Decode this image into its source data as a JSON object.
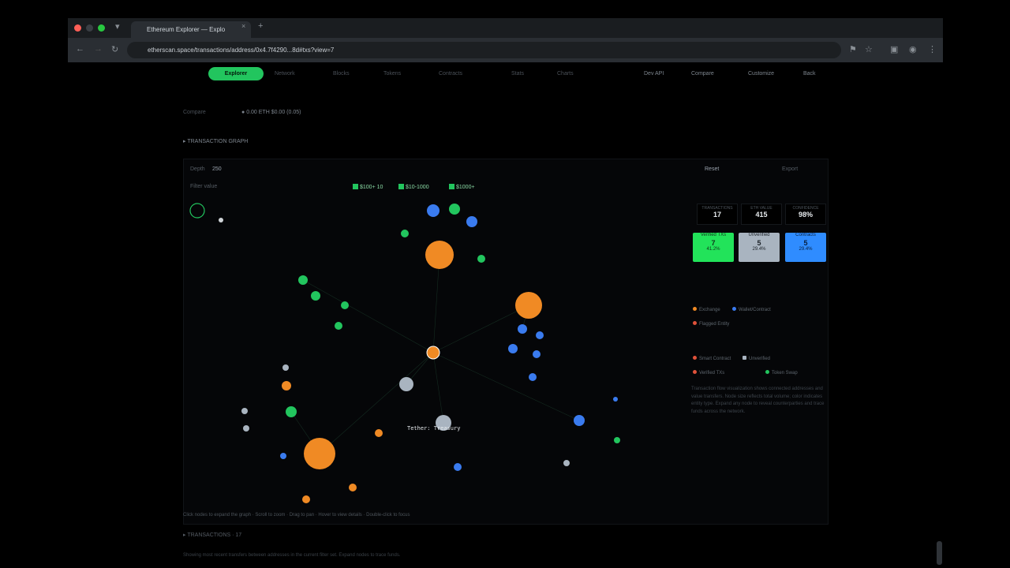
{
  "browser": {
    "tab_title": "Ethereum Explorer — Explo",
    "url": "etherscan.space/transactions/address/0x4.7f4290...8d#txs?view=7"
  },
  "nav": {
    "active": "Explorer",
    "items": [
      "Network",
      "Blocks",
      "Tokens",
      "Contracts",
      "Stats",
      "Charts"
    ],
    "right": [
      "Dev API",
      "Compare",
      "Customize",
      "Back"
    ]
  },
  "subnav": {
    "selected_label": "Compare",
    "selected_value": "0.00 ETH  $0.00 (0.05)"
  },
  "section_title": "▸ TRANSACTION GRAPH",
  "controls": {
    "depth_label": "Depth",
    "depth_value": "250",
    "filters_label": "Filter value",
    "chips": [
      "$100+ 10",
      "$10-1000 ",
      "$1000+"
    ],
    "right_label": "Reset",
    "export_label": "Export"
  },
  "stats": [
    {
      "label": "TRANSACTIONS",
      "value": "17"
    },
    {
      "label": "ETH VALUE",
      "value": "415"
    },
    {
      "label": "CONFIDENCE",
      "value": "98%"
    }
  ],
  "cards": [
    {
      "title": "Verified TXs",
      "count": "7",
      "sub": "41.2%",
      "color": "#22e35a"
    },
    {
      "title": "Unverified",
      "count": "5",
      "sub": "29.4%",
      "color": "#a9b4c0"
    },
    {
      "title": "Contracts",
      "count": "5",
      "sub": "29.4%",
      "color": "#2f8cff"
    }
  ],
  "legend": [
    {
      "label": "Exchange",
      "color": "#f08a24"
    },
    {
      "label": "Wallet/Contract",
      "color": "#3a7bef"
    },
    {
      "label": "Flagged Entity",
      "color": "#e0523a"
    },
    {
      "label": "Smart Contract",
      "color": "#e0523a"
    },
    {
      "label": "Unverified",
      "color": "#a9b4c0"
    },
    {
      "label": "Verified TXs",
      "color": "#e0523a"
    },
    {
      "label": "Token Swap",
      "color": "#22c55e"
    }
  ],
  "highlight_label": "Tether: Treasury",
  "footer_note": "Click nodes to expand the graph · Scroll to zoom · Drag to pan · Hover to view details · Double-click to focus",
  "footer_section": "▸ TRANSACTIONS · 17",
  "footer_text": "Showing most recent transfers between addresses in the current filter set. Expand nodes to trace funds."
}
